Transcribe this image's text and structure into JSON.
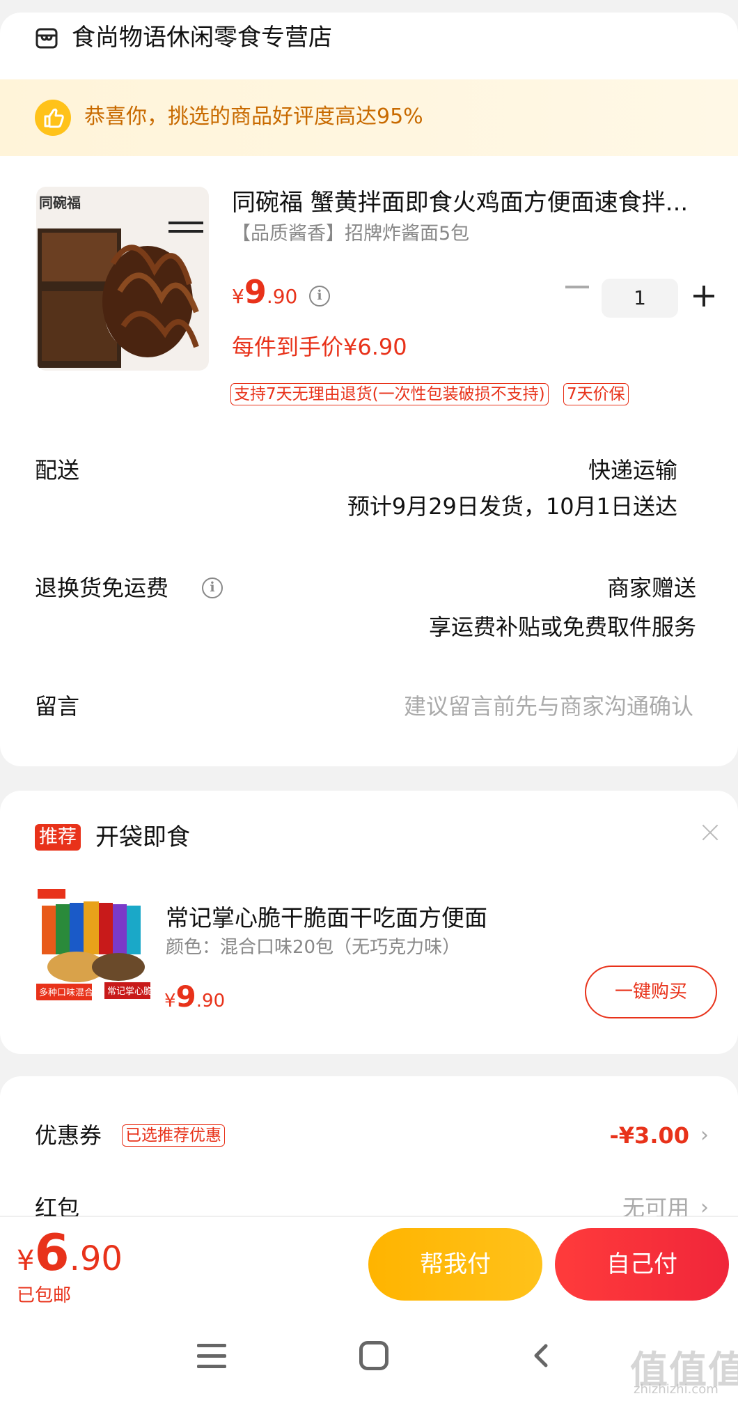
{
  "store": {
    "name": "食尚物语休闲零食专营店"
  },
  "banner": {
    "text": "恭喜你，挑选的商品好评度高达95%"
  },
  "product": {
    "title": "同碗福 蟹黄拌面即食火鸡面方便面速食拌...",
    "sku": "【品质酱香】招牌炸酱面5包",
    "price": {
      "currency": "¥",
      "int": "9",
      "dec": ".90"
    },
    "quantity": "1",
    "final_price": "每件到手价¥6.90",
    "tags": [
      "支持7天无理由退货(一次性包装破损不支持)",
      "7天价保"
    ]
  },
  "delivery": {
    "label": "配送",
    "method": "快递运输",
    "estimate": "预计9月29日发货，10月1日送达"
  },
  "return_shipping": {
    "label": "退换货免运费",
    "value": "商家赠送",
    "detail": "享运费补贴或免费取件服务"
  },
  "message": {
    "label": "留言",
    "placeholder": "建议留言前先与商家沟通确认"
  },
  "recommendation": {
    "badge": "推荐",
    "title": "开袋即食",
    "item": {
      "name": "常记掌心脆干脆面干吃面方便面",
      "sku": "颜色：混合口味20包（无巧克力味）",
      "price": {
        "currency": "¥",
        "int": "9",
        "dec": ".90"
      },
      "buy_label": "一键购买"
    }
  },
  "discount": {
    "coupon_label": "优惠券",
    "coupon_tag": "已选推荐优惠",
    "coupon_value": "-¥3.00",
    "redpacket_label": "红包",
    "redpacket_value": "无可用"
  },
  "bottom": {
    "total": {
      "currency": "¥",
      "int": "6",
      "dec": ".90"
    },
    "shipping_note": "已包邮",
    "help_pay": "帮我付",
    "self_pay": "自己付"
  },
  "watermark": {
    "main": "值值值",
    "sub": "zhizhizhi.com"
  },
  "colors": {
    "accent": "#e8321a",
    "banner_text": "#c86a00",
    "help_btn": "#ffb400",
    "self_btn": "#f0263a"
  }
}
